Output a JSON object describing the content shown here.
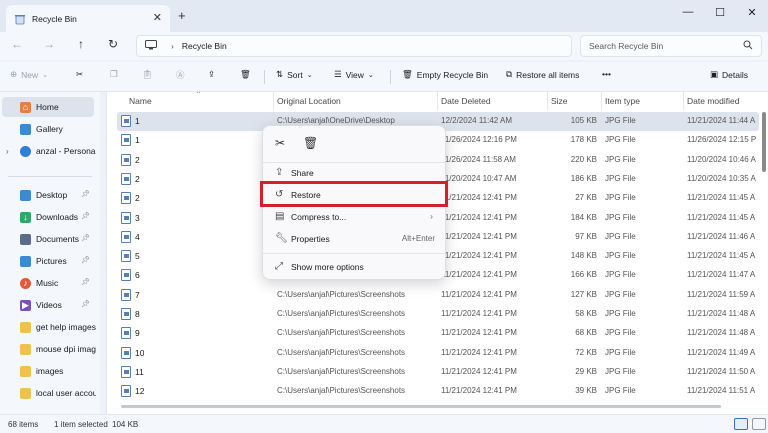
{
  "window": {
    "tab_title": "Recycle Bin",
    "tab_close": "✕",
    "new_tab": "+",
    "min": "—",
    "max": "☐",
    "close": "✕"
  },
  "address": {
    "location": "Recycle Bin",
    "separator": "›",
    "search_placeholder": "Search Recycle Bin"
  },
  "toolbar": {
    "new_label": "New",
    "sort_label": "Sort",
    "view_label": "View",
    "empty_label": "Empty Recycle Bin",
    "restore_all_label": "Restore all items",
    "more_label": "•••",
    "details_label": "Details"
  },
  "sidebar": {
    "home": "Home",
    "gallery": "Gallery",
    "personal": "anzal - Personal",
    "desktop": "Desktop",
    "downloads": "Downloads",
    "documents": "Documents",
    "pictures": "Pictures",
    "music": "Music",
    "videos": "Videos",
    "folder1": "get help images",
    "folder2": "mouse dpi imag",
    "folder3": "images",
    "folder4": "local user accou"
  },
  "columns": {
    "name": "Name",
    "location": "Original Location",
    "deleted": "Date Deleted",
    "size": "Size",
    "type": "Item type",
    "modified": "Date modified"
  },
  "rows": [
    {
      "name": "1",
      "location": "C:\\Users\\anjal\\OneDrive\\Desktop",
      "deleted": "12/2/2024 11:42 AM",
      "size": "105 KB",
      "type": "JPG File",
      "modified": "11/21/2024 11:44 A"
    },
    {
      "name": "1",
      "location": "",
      "deleted": "11/26/2024 12:16 PM",
      "size": "178 KB",
      "type": "JPG File",
      "modified": "11/26/2024 12:15 P"
    },
    {
      "name": "2",
      "location": "",
      "deleted": "11/26/2024 11:58 AM",
      "size": "220 KB",
      "type": "JPG File",
      "modified": "11/20/2024 10:46 A"
    },
    {
      "name": "2",
      "location": "",
      "deleted": "11/20/2024 10:47 AM",
      "size": "186 KB",
      "type": "JPG File",
      "modified": "11/20/2024 10:35 A"
    },
    {
      "name": "2",
      "location": "",
      "deleted": "11/21/2024 12:41 PM",
      "size": "27 KB",
      "type": "JPG File",
      "modified": "11/21/2024 11:45 A"
    },
    {
      "name": "3",
      "location": "",
      "deleted": "11/21/2024 12:41 PM",
      "size": "184 KB",
      "type": "JPG File",
      "modified": "11/21/2024 11:45 A"
    },
    {
      "name": "4",
      "location": "",
      "deleted": "11/21/2024 12:41 PM",
      "size": "97 KB",
      "type": "JPG File",
      "modified": "11/21/2024 11:46 A"
    },
    {
      "name": "5",
      "location": "",
      "deleted": "11/21/2024 12:41 PM",
      "size": "148 KB",
      "type": "JPG File",
      "modified": "11/21/2024 11:45 A"
    },
    {
      "name": "6",
      "location": "",
      "deleted": "11/21/2024 12:41 PM",
      "size": "166 KB",
      "type": "JPG File",
      "modified": "11/21/2024 11:47 A"
    },
    {
      "name": "7",
      "location": "C:\\Users\\anjal\\Pictures\\Screenshots",
      "deleted": "11/21/2024 12:41 PM",
      "size": "127 KB",
      "type": "JPG File",
      "modified": "11/21/2024 11:59 A"
    },
    {
      "name": "8",
      "location": "C:\\Users\\anjal\\Pictures\\Screenshots",
      "deleted": "11/21/2024 12:41 PM",
      "size": "58 KB",
      "type": "JPG File",
      "modified": "11/21/2024 11:48 A"
    },
    {
      "name": "9",
      "location": "C:\\Users\\anjal\\Pictures\\Screenshots",
      "deleted": "11/21/2024 12:41 PM",
      "size": "68 KB",
      "type": "JPG File",
      "modified": "11/21/2024 11:48 A"
    },
    {
      "name": "10",
      "location": "C:\\Users\\anjal\\Pictures\\Screenshots",
      "deleted": "11/21/2024 12:41 PM",
      "size": "72 KB",
      "type": "JPG File",
      "modified": "11/21/2024 11:49 A"
    },
    {
      "name": "11",
      "location": "C:\\Users\\anjal\\Pictures\\Screenshots",
      "deleted": "11/21/2024 12:41 PM",
      "size": "29 KB",
      "type": "JPG File",
      "modified": "11/21/2024 11:50 A"
    },
    {
      "name": "12",
      "location": "C:\\Users\\anjal\\Pictures\\Screenshots",
      "deleted": "11/21/2024 12:41 PM",
      "size": "39 KB",
      "type": "JPG File",
      "modified": "11/21/2024 11:51 A"
    }
  ],
  "context_menu": {
    "share": "Share",
    "restore": "Restore",
    "compress": "Compress to...",
    "properties": "Properties",
    "properties_shortcut": "Alt+Enter",
    "more_options": "Show more options"
  },
  "status": {
    "count": "68 items",
    "selected": "1 item selected",
    "size": "104 KB"
  },
  "colors": {
    "highlight_border": "#d32030",
    "selected_row": "#dde3ec",
    "accent": "#3b6fc4"
  }
}
